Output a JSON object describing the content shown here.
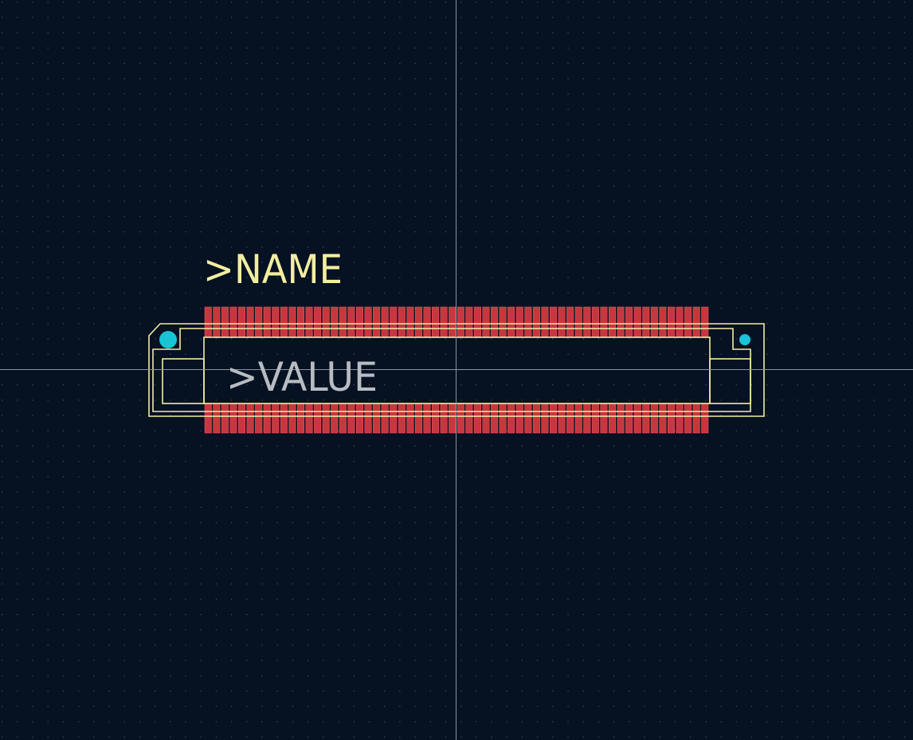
{
  "footprint": {
    "name_label": ">NAME",
    "value_label": ">VALUE",
    "top_pad_count": 60,
    "bottom_pad_count": 60
  },
  "colors": {
    "background": "#061122",
    "grid_dot": "#3a4a60",
    "crosshair": "#8a93a0",
    "silkscreen": "#f2eea0",
    "pad": "#c8363f",
    "pad_outline": "#ff5a66",
    "value_text": "#b8bcc2",
    "drill": "#18c4d6"
  }
}
